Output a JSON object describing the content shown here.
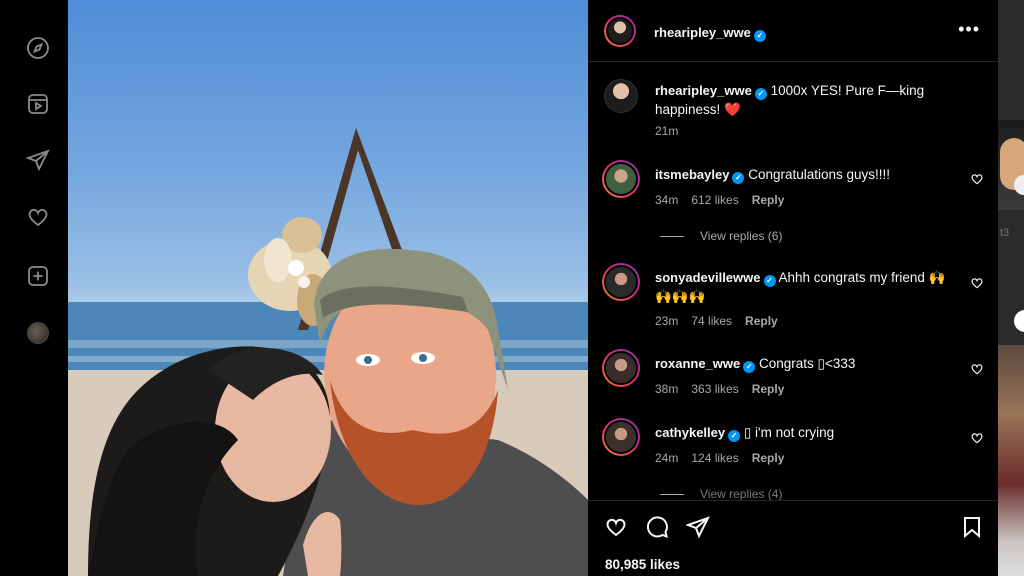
{
  "post": {
    "username": "rhearipley_wwe",
    "more_label": "•••"
  },
  "caption": {
    "username": "rhearipley_wwe",
    "text": "1000x YES! Pure F—king happiness! ❤️",
    "time": "21m"
  },
  "comments": [
    {
      "username": "itsmebayley",
      "text": "Congratulations guys!!!!",
      "time": "34m",
      "likes": "612 likes",
      "reply": "Reply"
    },
    {
      "username": "sonyadevillewwe",
      "text": "Ahhh congrats my friend 🙌 🙌🙌🙌",
      "time": "23m",
      "likes": "74 likes",
      "reply": "Reply"
    },
    {
      "username": "roxanne_wwe",
      "text": "Congrats ▯<333",
      "time": "38m",
      "likes": "363 likes",
      "reply": "Reply"
    },
    {
      "username": "cathykelley",
      "text": "▯ i'm not crying",
      "time": "24m",
      "likes": "124 likes",
      "reply": "Reply"
    }
  ],
  "view_replies": "View replies (6)",
  "view_replies_partial": "View replies (4)",
  "likes_count": "80,985 likes",
  "edge_peek_text": "t3",
  "icons": {
    "rail": [
      "explore-icon",
      "reels-icon",
      "send-icon",
      "heart-icon",
      "create-icon"
    ],
    "actions": [
      "like-icon",
      "comment-icon",
      "share-icon",
      "save-icon"
    ]
  },
  "colors": {
    "verified": "#0095f6",
    "heart": "#ed4956",
    "muted": "#a8a8a8"
  }
}
